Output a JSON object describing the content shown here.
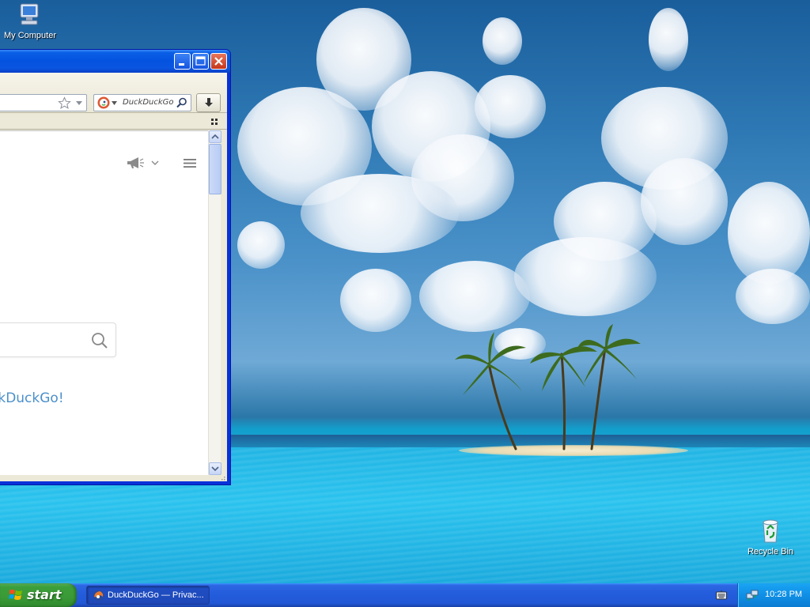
{
  "desktop": {
    "icons": [
      {
        "label": "My Computer",
        "icon": "my-computer-icon"
      },
      {
        "label": "Recycle Bin",
        "icon": "recycle-bin-icon"
      }
    ]
  },
  "window": {
    "controls": {
      "minimize": "minimize-icon",
      "maximize": "maximize-icon",
      "close": "close-icon"
    },
    "toolbar": {
      "search_engine": "DuckDuckGo",
      "search_placeholder": "DuckDuckGo",
      "bookmark_icon": "star-icon",
      "download_icon": "download-arrow-icon"
    },
    "page": {
      "link_text": "ckDuckGo!",
      "search_icon": "magnifier-icon",
      "header_icons": [
        "megaphone-icon",
        "chevron-down-icon",
        "hamburger-menu-icon"
      ]
    }
  },
  "taskbar": {
    "start_label": "start",
    "task_label": "DuckDuckGo — Privac...",
    "clock": "10:28 PM"
  },
  "colors": {
    "taskbar_blue": "#245edc",
    "start_green": "#3c9f3a",
    "title_blue": "#0452df",
    "link_blue": "#4b8fcb"
  }
}
